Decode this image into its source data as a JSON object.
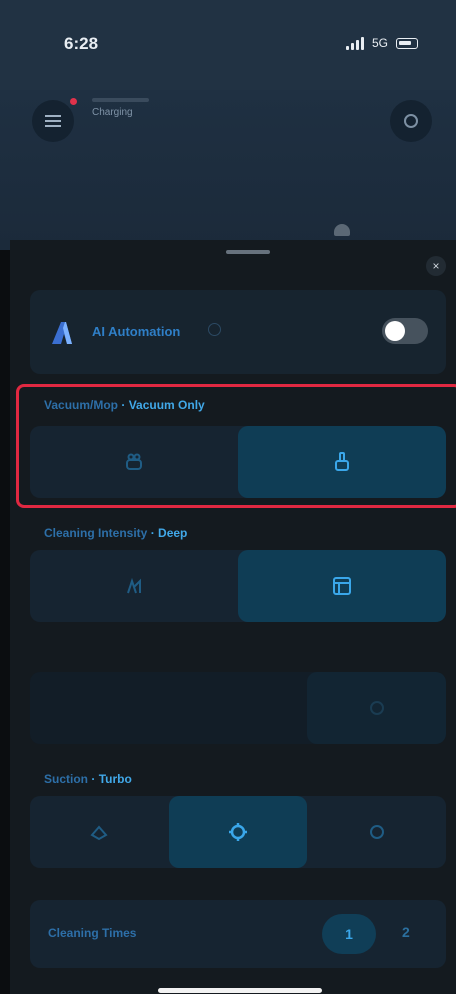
{
  "status_bar": {
    "time": "6:28",
    "network": "5G"
  },
  "device": {
    "name": "",
    "status": "Charging",
    "battery": ""
  },
  "panel": {
    "close_glyph": "×",
    "ai": {
      "label": "AI Automation",
      "enabled": false
    },
    "vacuum_mop": {
      "label": "Vacuum/Mop",
      "value": "Vacuum Only",
      "selected_index": 1
    },
    "cleaning_intensity": {
      "label": "Cleaning Intensity",
      "value": "Deep",
      "selected_index": 1
    },
    "mop_water_level": {
      "label": ""
    },
    "suction": {
      "label": "Suction",
      "value": "Turbo",
      "selected_index": 1
    },
    "cleaning_times": {
      "label": "Cleaning Times",
      "options": [
        "1",
        "2"
      ],
      "selected": "1"
    }
  },
  "colors": {
    "accent": "#41a8e8",
    "highlight": "#e02841",
    "selected_bg": "#0f3d55"
  }
}
